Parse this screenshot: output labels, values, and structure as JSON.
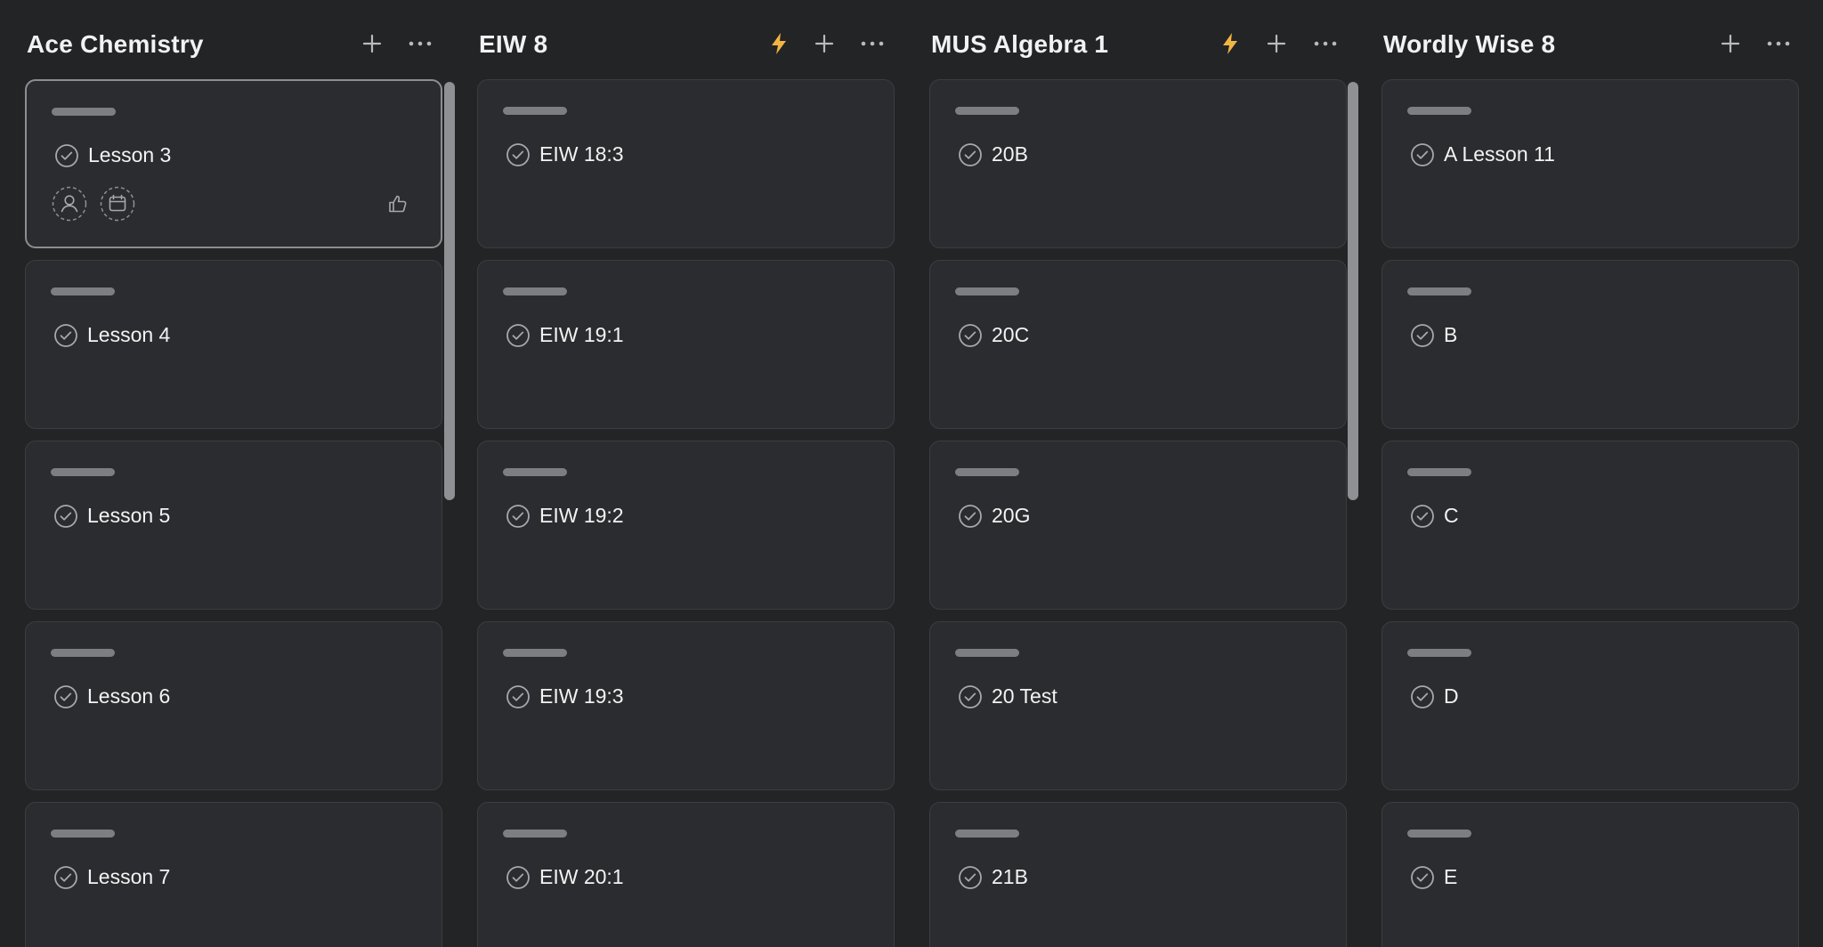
{
  "colors": {
    "background": "#232426",
    "card": "#2b2c2f",
    "lightning": "#f1b544",
    "muted_icon": "#a7a8ab"
  },
  "columns": [
    {
      "title": "Ace Chemistry",
      "has_lightning": false,
      "add_icon": "plus-icon",
      "more_icon": "ellipsis-icon",
      "cards": [
        {
          "title": "Lesson 3"
        },
        {
          "title": "Lesson 4"
        },
        {
          "title": "Lesson 5"
        },
        {
          "title": "Lesson 6"
        },
        {
          "title": "Lesson 7"
        }
      ]
    },
    {
      "title": "EIW 8",
      "has_lightning": true,
      "add_icon": "plus-icon",
      "more_icon": "ellipsis-icon",
      "cards": [
        {
          "title": "EIW 18:3"
        },
        {
          "title": "EIW 19:1"
        },
        {
          "title": "EIW 19:2"
        },
        {
          "title": "EIW 19:3"
        },
        {
          "title": "EIW 20:1"
        }
      ]
    },
    {
      "title": "MUS Algebra 1",
      "has_lightning": true,
      "add_icon": "plus-icon",
      "more_icon": "ellipsis-icon",
      "cards": [
        {
          "title": "20B"
        },
        {
          "title": "20C"
        },
        {
          "title": "20G"
        },
        {
          "title": "20 Test"
        },
        {
          "title": "21B"
        }
      ]
    },
    {
      "title": "Wordly Wise 8",
      "has_lightning": false,
      "add_icon": "plus-icon",
      "more_icon": "ellipsis-icon",
      "cards": [
        {
          "title": "A Lesson 11"
        },
        {
          "title": "B"
        },
        {
          "title": "C"
        },
        {
          "title": "D"
        },
        {
          "title": "E"
        }
      ]
    }
  ]
}
